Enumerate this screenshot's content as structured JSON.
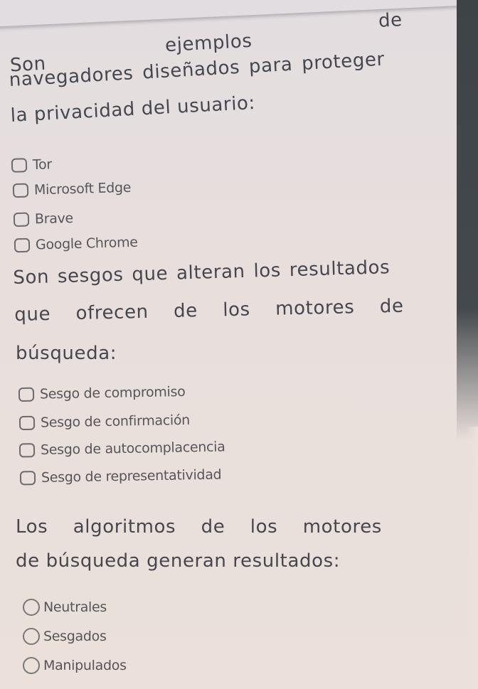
{
  "questions": [
    {
      "type": "checkbox",
      "lines": [
        "de",
        "ejemplos",
        "Son",
        "navegadores  diseñados  para  proteger",
        "la privacidad del usuario:"
      ],
      "options": [
        "Tor",
        "Microsoft Edge",
        "Brave",
        "Google Chrome"
      ]
    },
    {
      "type": "checkbox",
      "lines": [
        "Son sesgos que alteran los resultados",
        "que    ofrecen    de    los    motores    de",
        "búsqueda:"
      ],
      "options": [
        "Sesgo de compromiso",
        "Sesgo de confirmación",
        "Sesgo de autocomplacencia",
        "Sesgo de representatividad"
      ]
    },
    {
      "type": "radio",
      "lines": [
        "Los    algoritmos    de    los    motores",
        "de búsqueda generan resultados:"
      ],
      "options": [
        "Neutrales",
        "Sesgados",
        "Manipulados"
      ]
    }
  ],
  "colors": {
    "paper": "#e8dfdc",
    "text": "#45464f",
    "background_edge": "#3e4347"
  }
}
